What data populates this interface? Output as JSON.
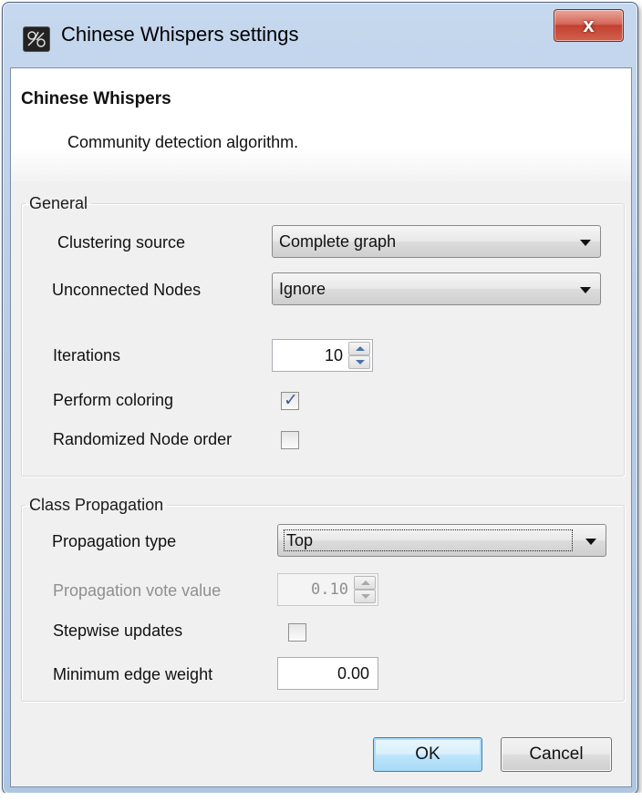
{
  "window": {
    "title": "Chinese Whispers settings",
    "close_label": "x"
  },
  "header": {
    "title": "Chinese Whispers",
    "description": "Community detection algorithm."
  },
  "general": {
    "legend": "General",
    "clustering_source_label": "Clustering source",
    "clustering_source_value": "Complete graph",
    "unconnected_nodes_label": "Unconnected Nodes",
    "unconnected_nodes_value": "Ignore",
    "iterations_label": "Iterations",
    "iterations_value": "10",
    "perform_coloring_label": "Perform coloring",
    "perform_coloring_checked": true,
    "randomized_order_label": "Randomized Node order",
    "randomized_order_checked": false
  },
  "class_propagation": {
    "legend": "Class Propagation",
    "propagation_type_label": "Propagation type",
    "propagation_type_value": "Top",
    "vote_value_label": "Propagation vote value",
    "vote_value": "0.10",
    "stepwise_label": "Stepwise updates",
    "stepwise_checked": false,
    "min_edge_weight_label": "Minimum edge weight",
    "min_edge_weight_value": "0.00"
  },
  "buttons": {
    "ok": "OK",
    "cancel": "Cancel"
  }
}
